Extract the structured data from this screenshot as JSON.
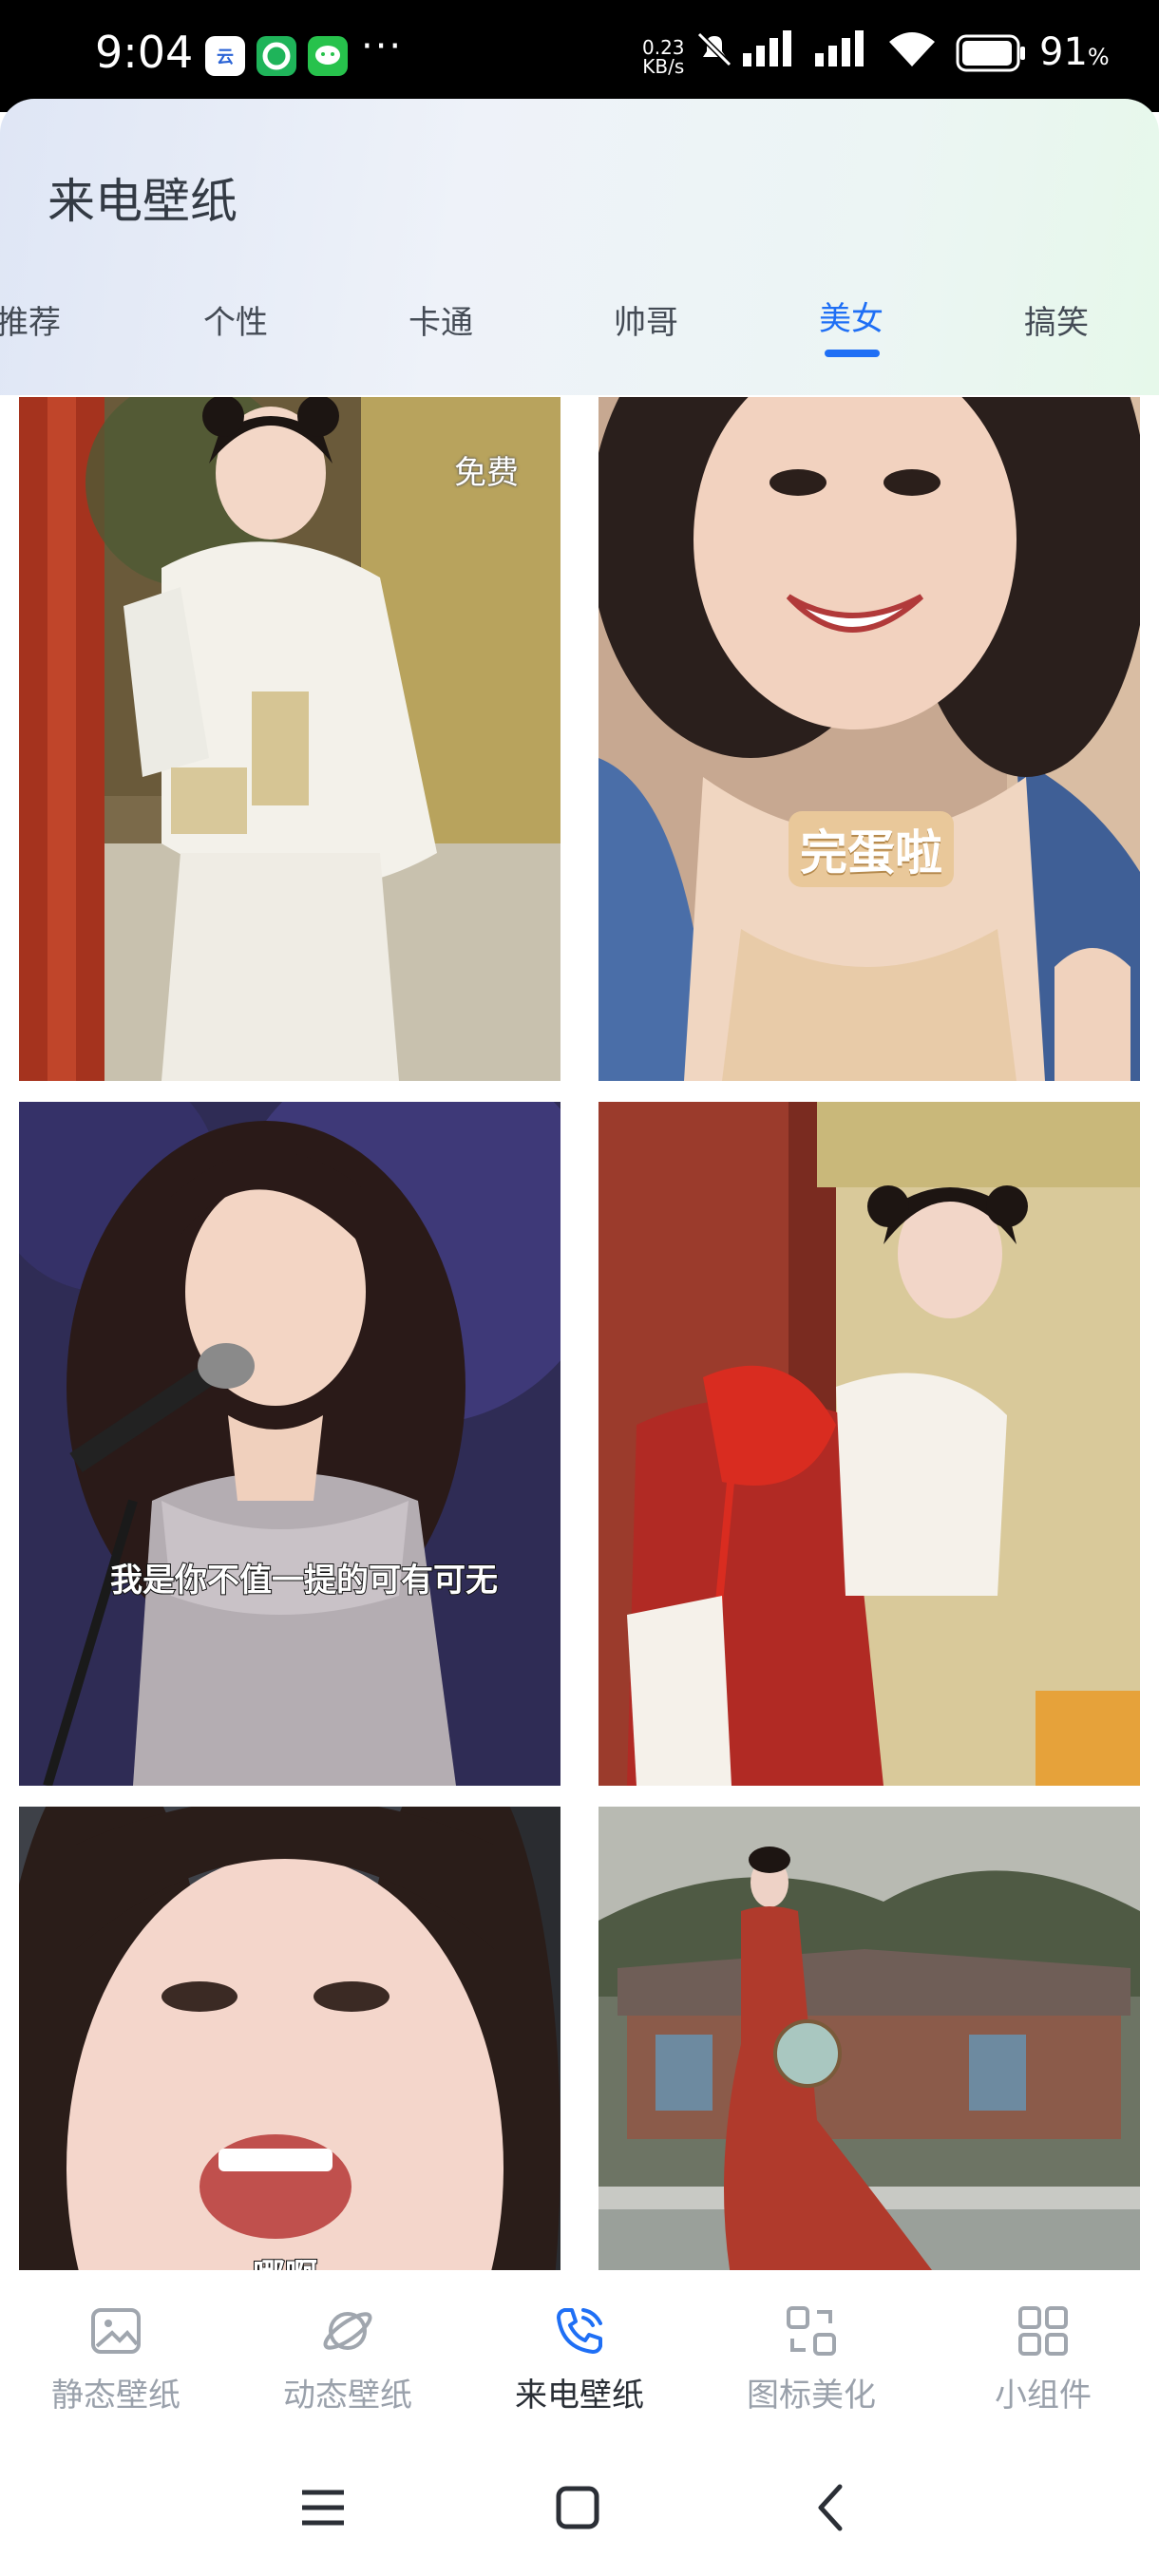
{
  "status_bar": {
    "time": "9:04",
    "more": "···",
    "net_speed_value": "0.23",
    "net_speed_unit": "KB/s",
    "battery_level": "91",
    "battery_unit": "%",
    "icons": [
      "cloud-app-icon",
      "sync-app-icon",
      "wechat-icon",
      "mute-icon",
      "signal-icon",
      "signal-icon",
      "wifi-icon",
      "battery-icon"
    ]
  },
  "header": {
    "title": "来电壁纸"
  },
  "tabs": [
    {
      "label": "推荐",
      "active": false
    },
    {
      "label": "个性",
      "active": false
    },
    {
      "label": "卡通",
      "active": false
    },
    {
      "label": "帅哥",
      "active": false
    },
    {
      "label": "美女",
      "active": true
    },
    {
      "label": "搞笑",
      "active": false
    }
  ],
  "cards": [
    {
      "badge": "免费"
    },
    {
      "sticker": "完蛋啦"
    },
    {
      "caption": "我是你不值一提的可有可无"
    },
    {},
    {
      "caption": "哪啊"
    },
    {}
  ],
  "bottom_nav": [
    {
      "label": "静态壁纸",
      "icon": "image-icon",
      "active": false
    },
    {
      "label": "动态壁纸",
      "icon": "planet-icon",
      "active": false
    },
    {
      "label": "来电壁纸",
      "icon": "phone-call-icon",
      "active": true
    },
    {
      "label": "图标美化",
      "icon": "swap-icon",
      "active": false
    },
    {
      "label": "小组件",
      "icon": "widgets-icon",
      "active": false
    }
  ],
  "colors": {
    "accent": "#1f6ff5",
    "inactive_label": "#9aa1ab"
  }
}
